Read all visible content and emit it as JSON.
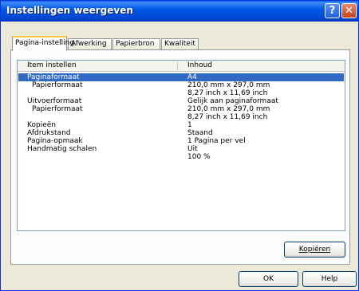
{
  "window": {
    "title": "Instellingen weergeven",
    "help": "?",
    "close": "✕"
  },
  "tabs": [
    "Pagina-instelling",
    "Afwerking",
    "Papierbron",
    "Kwaliteit"
  ],
  "columns": {
    "item": "Item instellen",
    "value": "Inhoud"
  },
  "rows": [
    {
      "item": "Paginaformaat",
      "value": "A4",
      "selected": true
    },
    {
      "item": "Papierformaat",
      "value": "210,0 mm x 297,0 mm",
      "indent": true
    },
    {
      "item": "",
      "value": "8,27 inch x 11,69 inch"
    },
    {
      "item": "Uitvoerformaat",
      "value": "Gelijk aan paginaformaat"
    },
    {
      "item": "Papierformaat",
      "value": "210,0 mm x 297,0 mm",
      "indent": true
    },
    {
      "item": "",
      "value": "8,27 inch x 11,69 inch"
    },
    {
      "item": "Kopieën",
      "value": "1"
    },
    {
      "item": "Afdrukstand",
      "value": "Staand"
    },
    {
      "item": "Pagina-opmaak",
      "value": "1 Pagina per vel"
    },
    {
      "item": "Handmatig schalen",
      "value": "Uit"
    },
    {
      "item": "",
      "value": "100 %"
    }
  ],
  "buttons": {
    "copy": "Kopiëren",
    "ok": "OK",
    "help": "Help"
  }
}
